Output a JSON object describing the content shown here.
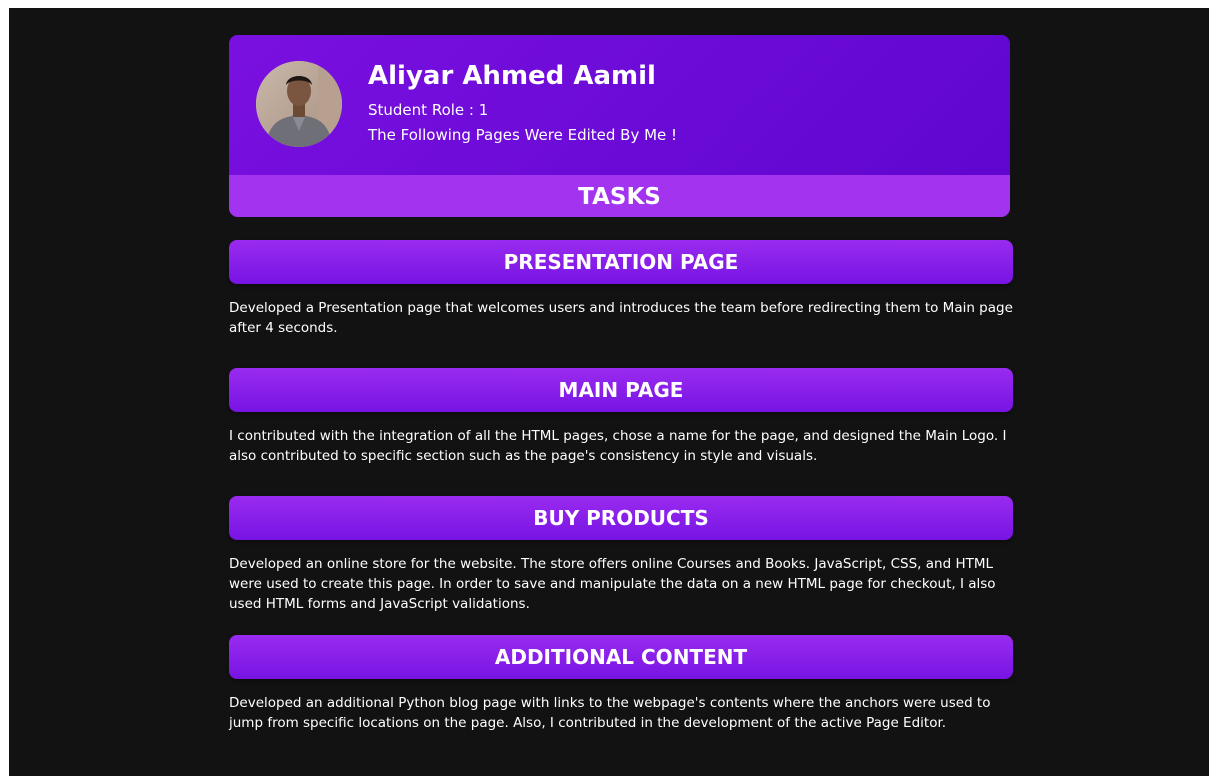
{
  "profile": {
    "name": "Aliyar Ahmed Aamil",
    "role": "Student Role : 1",
    "description": "The Following Pages Were Edited By Me !"
  },
  "tasks_title": "TASKS",
  "tasks": [
    {
      "title": "PRESENTATION PAGE",
      "description": "Developed a Presentation page that welcomes users and introduces the team before redirecting them to Main page after 4 seconds."
    },
    {
      "title": "MAIN PAGE",
      "description": "I contributed with the integration of all the HTML pages, chose a name for the page, and designed the Main Logo. I also contributed to specific section such as the page's consistency in style and visuals."
    },
    {
      "title": "BUY PRODUCTS",
      "description": "Developed an online store for the website. The store offers online Courses and Books. JavaScript, CSS, and HTML were used to create this page. In order to save and manipulate the data on a new HTML page for checkout, I also used HTML forms and JavaScript validations."
    },
    {
      "title": "ADDITIONAL CONTENT",
      "description": "Developed an additional Python blog page with links to the webpage's contents where the anchors were used to jump from specific locations on the page. Also, I contributed in the development of the active Page Editor."
    }
  ],
  "colors": {
    "background": "#121212",
    "accent": "#6c0bd6",
    "tasks_bar": "#a233ef"
  }
}
